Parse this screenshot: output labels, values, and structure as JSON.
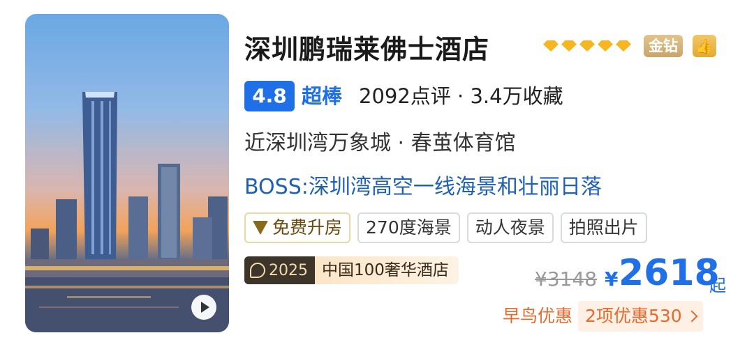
{
  "hotel": {
    "name": "深圳鹏瑞莱佛士酒店",
    "diamond_count": 5,
    "badge": "金钻",
    "thumb_icon": "thumbs-up-icon"
  },
  "rating": {
    "score": "4.8",
    "word": "超棒",
    "reviews": "2092点评 · 3.4万收藏"
  },
  "location": "近深圳湾万象城 · 春茧体育馆",
  "boss_note": "BOSS:深圳湾高空一线海景和壮丽日落",
  "tags": [
    {
      "label": "免费升房",
      "icon": "upgrade-heart-icon"
    },
    {
      "label": "270度海景"
    },
    {
      "label": "动人夜景"
    },
    {
      "label": "拍照出片"
    }
  ],
  "award": {
    "year": "2025",
    "text": "中国100奢华酒店"
  },
  "price": {
    "original": "¥3148",
    "currency": "¥",
    "current": "2618",
    "suffix": "起"
  },
  "promo": {
    "early_bird": "早鸟优惠",
    "offers": "2项优惠530"
  },
  "colors": {
    "accent_blue": "#1f6fe8",
    "promo_orange": "#e8692b",
    "diamond_gold": "#f5b622"
  }
}
